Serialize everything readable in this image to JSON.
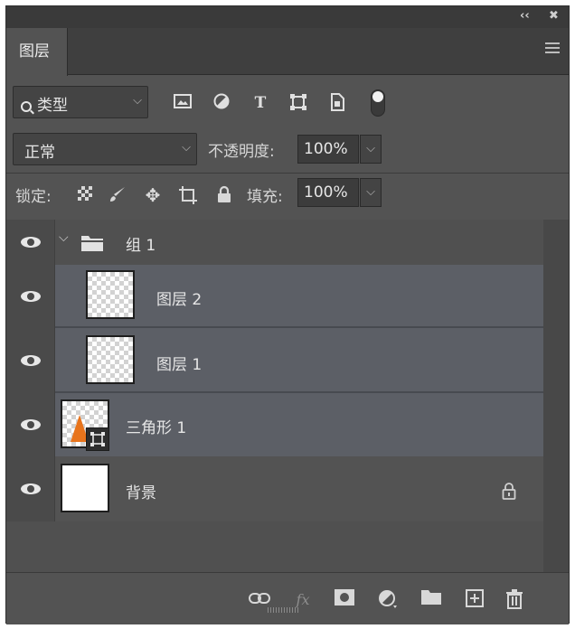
{
  "window": {
    "collapse_glyph": "‹‹",
    "close_glyph": "✖"
  },
  "tab": {
    "label": "图层",
    "menu_icon": "hamburger-menu-icon"
  },
  "filter": {
    "kind_label": "类型",
    "icons": [
      "pixel-filter-icon",
      "adjustment-filter-icon",
      "type-filter-icon",
      "shape-filter-icon",
      "smart-object-filter-icon"
    ]
  },
  "blend": {
    "mode": "正常",
    "opacity_label": "不透明度:",
    "opacity_value": "100%"
  },
  "lock": {
    "label": "锁定:",
    "icons": [
      "lock-transparent-icon",
      "lock-paint-icon",
      "lock-position-icon",
      "lock-artboard-icon",
      "lock-all-icon"
    ],
    "fill_label": "填充:",
    "fill_value": "100%"
  },
  "layers": [
    {
      "name": "组 1",
      "type": "group",
      "visible": true
    },
    {
      "name": "图层 2",
      "type": "pixel",
      "visible": true,
      "selected": true
    },
    {
      "name": "图层 1",
      "type": "pixel",
      "visible": true,
      "selected": true
    },
    {
      "name": "三角形 1",
      "type": "shape",
      "visible": true,
      "selected": true
    },
    {
      "name": "背景",
      "type": "background",
      "visible": true,
      "locked": true
    }
  ],
  "footer": {
    "icons": [
      "link-layers-icon",
      "fx-icon",
      "add-mask-icon",
      "new-adjustment-icon",
      "new-group-icon",
      "new-layer-icon",
      "delete-icon"
    ],
    "fx_text": "fx"
  },
  "colors": {
    "panel": "#535353",
    "selected_row": "#5c5f66",
    "shape_fill": "#e8741c"
  }
}
